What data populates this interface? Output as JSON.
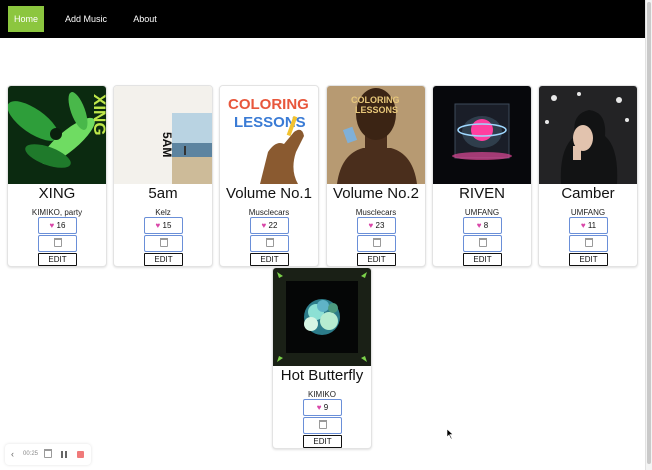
{
  "nav": {
    "links": [
      {
        "label": "Home",
        "active": true
      },
      {
        "label": "Add Music",
        "active": false
      },
      {
        "label": "About",
        "active": false
      }
    ],
    "active_color": "#8cc63f"
  },
  "songs": [
    {
      "title": "XING",
      "artist": "KIMIKO, party",
      "likes": "16",
      "edit_label": "EDIT"
    },
    {
      "title": "5am",
      "artist": "Kelz",
      "likes": "15",
      "edit_label": "EDIT"
    },
    {
      "title": "Volume No.1",
      "artist": "Musclecars",
      "likes": "22",
      "edit_label": "EDIT"
    },
    {
      "title": "Volume No.2",
      "artist": "Musclecars",
      "likes": "23",
      "edit_label": "EDIT"
    },
    {
      "title": "RIVEN",
      "artist": "UMFANG",
      "likes": "8",
      "edit_label": "EDIT"
    },
    {
      "title": "Camber",
      "artist": "UMFANG",
      "likes": "11",
      "edit_label": "EDIT"
    },
    {
      "title": "Hot Butterfly",
      "artist": "KIMIKO",
      "likes": "9",
      "edit_label": "EDIT"
    }
  ],
  "cover_text": {
    "xing": "XING",
    "fiveam": "5AM",
    "coloring_line1": "COLORING",
    "coloring_line2": "LESSONS"
  },
  "icons": {
    "like": "heart-icon",
    "delete": "trash-icon",
    "player_back": "chevron-left-icon",
    "player_delete": "trash-icon",
    "player_pause": "pause-icon",
    "player_stop": "stop-icon"
  },
  "player": {
    "time": "00:25"
  }
}
